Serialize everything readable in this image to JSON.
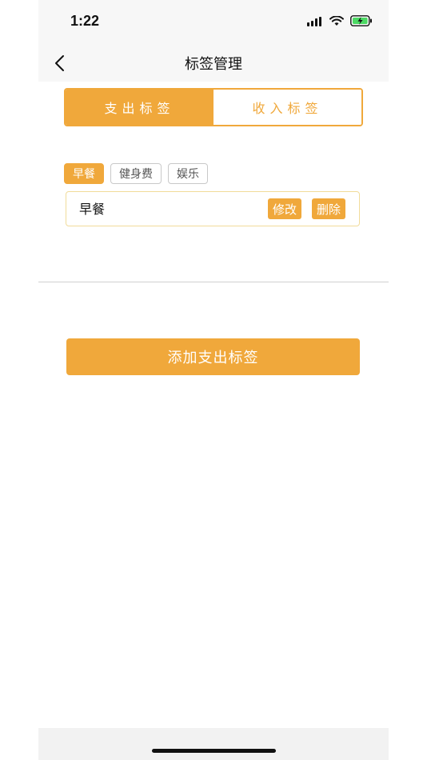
{
  "status": {
    "time": "1:22",
    "signal_icon": "cellular-signal-icon",
    "wifi_icon": "wifi-icon",
    "battery_icon": "battery-charging-icon",
    "battery_color": "#4cd964"
  },
  "nav": {
    "title": "标签管理",
    "back_icon": "chevron-left-icon"
  },
  "segment": {
    "expense_label": "支出标签",
    "income_label": "收入标签",
    "selected": "expense"
  },
  "tags": [
    {
      "label": "早餐",
      "selected": true
    },
    {
      "label": "健身费",
      "selected": false
    },
    {
      "label": "娱乐",
      "selected": false
    }
  ],
  "editor": {
    "value": "早餐",
    "modify_label": "修改",
    "delete_label": "删除"
  },
  "add_button_label": "添加支出标签",
  "colors": {
    "accent": "#f0a83b",
    "input_border": "#f1dc9a"
  }
}
